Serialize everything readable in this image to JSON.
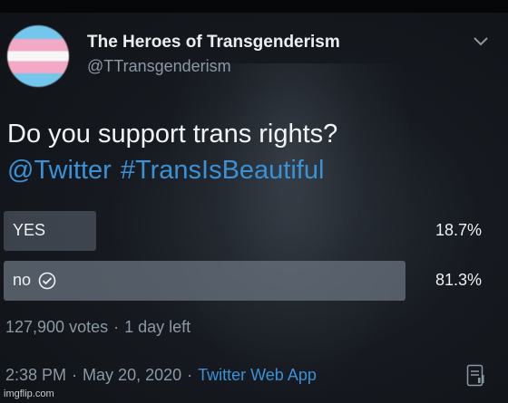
{
  "account": {
    "display_name": "The Heroes of Transgenderism",
    "handle": "@TTransgenderism"
  },
  "tweet": {
    "question": "Do you support trans rights?",
    "mention": "@Twitter",
    "hashtag": "#TransIsBeautiful"
  },
  "poll": {
    "options": [
      {
        "label": "YES",
        "percent_text": "18.7%",
        "percent": 18.7,
        "selected": false
      },
      {
        "label": "no",
        "percent_text": "81.3%",
        "percent": 81.3,
        "selected": true
      }
    ],
    "votes_text": "127,900 votes",
    "time_left": "1 day left"
  },
  "meta": {
    "time": "2:38 PM",
    "date": "May 20, 2020",
    "client": "Twitter Web App"
  },
  "watermark": "imgflip.com",
  "icons": {
    "menu": "chevron-down-icon",
    "selected": "check-circle-icon",
    "stats": "analytics-icon"
  },
  "colors": {
    "link": "#3a91d6",
    "muted": "#8b98a5",
    "text": "#e8eaed"
  }
}
